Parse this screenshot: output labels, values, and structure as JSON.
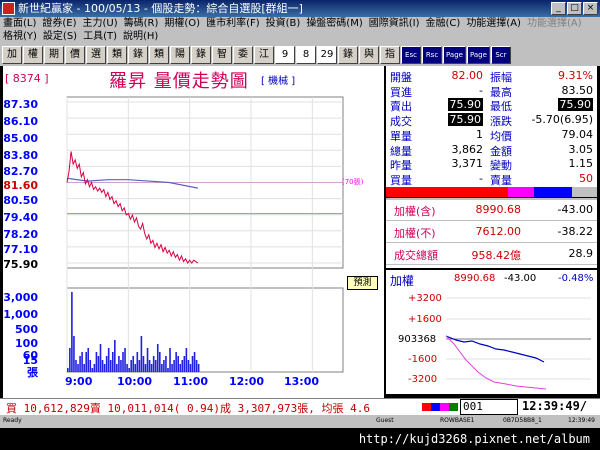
{
  "title": "新世紀贏家 - 100/05/13 - 個股走勢：綜合自選股[群組一]",
  "menu1": [
    "畫面(L)",
    "證券(E)",
    "主力(U)",
    "籌碼(R)",
    "期權(O)",
    "匯市利率(F)",
    "投資(B)",
    "操盤密碼(M)",
    "國際資訊(I)",
    "金融(C)",
    "功能選擇(A)",
    "功能選擇(A)"
  ],
  "menu2": [
    "格視(Y)",
    "設定(S)",
    "工具(T)",
    "說明(H)"
  ],
  "toolbar": [
    "加",
    "權",
    "期",
    "價",
    "選",
    "類",
    "錄",
    "類",
    "陽",
    "錄",
    "智",
    "委",
    "江",
    "9",
    "8",
    "29",
    "錄",
    "與",
    "指",
    "Esc",
    "Rsc",
    "Page",
    "Page",
    "Scr"
  ],
  "stock": {
    "code": "[ 8374 ]",
    "name": "羅昇  量價走勢圖",
    "kind": "[ 機械 ]"
  },
  "axis": {
    "prices": [
      "87.30",
      "86.10",
      "85.00",
      "83.80",
      "82.70",
      "81.60",
      "80.50",
      "79.40",
      "78.20",
      "77.10",
      "75.90"
    ],
    "volumes": [
      "3,000",
      "1,000",
      "500",
      "100",
      "60",
      "30",
      "15"
    ],
    "vol_unit": "張",
    "times": [
      "9:00",
      "10:00",
      "11:00",
      "12:00",
      "13:00"
    ]
  },
  "price_tag": "(70張)",
  "predict": "預測",
  "chart_data": {
    "type": "line",
    "ylim": [
      75.9,
      87.3
    ],
    "xlim_minutes": [
      0,
      270
    ],
    "prev_close": 81.6,
    "price": [
      [
        0,
        81.6
      ],
      [
        2,
        82.4
      ],
      [
        4,
        83.8
      ],
      [
        6,
        82.9
      ],
      [
        8,
        83.2
      ],
      [
        10,
        82.6
      ],
      [
        12,
        82.9
      ],
      [
        14,
        82.0
      ],
      [
        16,
        82.3
      ],
      [
        18,
        81.5
      ],
      [
        20,
        81.8
      ],
      [
        22,
        81.3
      ],
      [
        24,
        81.6
      ],
      [
        26,
        81.1
      ],
      [
        28,
        81.3
      ],
      [
        30,
        81.0
      ],
      [
        32,
        81.2
      ],
      [
        34,
        80.9
      ],
      [
        36,
        81.1
      ],
      [
        38,
        80.6
      ],
      [
        40,
        80.9
      ],
      [
        42,
        80.4
      ],
      [
        44,
        80.6
      ],
      [
        46,
        80.1
      ],
      [
        48,
        80.3
      ],
      [
        50,
        79.9
      ],
      [
        52,
        80.1
      ],
      [
        54,
        79.6
      ],
      [
        56,
        79.8
      ],
      [
        58,
        79.3
      ],
      [
        60,
        79.4
      ],
      [
        62,
        79.0
      ],
      [
        64,
        79.3
      ],
      [
        66,
        78.8
      ],
      [
        68,
        79.1
      ],
      [
        70,
        78.5
      ],
      [
        72,
        78.3
      ],
      [
        74,
        78.7
      ],
      [
        76,
        78.0
      ],
      [
        78,
        77.6
      ],
      [
        80,
        77.9
      ],
      [
        82,
        77.3
      ],
      [
        84,
        77.5
      ],
      [
        86,
        77.0
      ],
      [
        88,
        77.3
      ],
      [
        90,
        76.9
      ],
      [
        92,
        77.2
      ],
      [
        94,
        76.7
      ],
      [
        96,
        77.0
      ],
      [
        98,
        76.6
      ],
      [
        100,
        76.8
      ],
      [
        102,
        76.4
      ],
      [
        104,
        76.7
      ],
      [
        106,
        76.3
      ],
      [
        108,
        76.5
      ],
      [
        110,
        76.1
      ],
      [
        112,
        76.4
      ],
      [
        114,
        76.0
      ],
      [
        116,
        76.2
      ],
      [
        118,
        75.9
      ],
      [
        120,
        76.1
      ],
      [
        122,
        75.9
      ],
      [
        124,
        76.1
      ],
      [
        126,
        76.0
      ],
      [
        128,
        75.9
      ]
    ],
    "avg": [
      [
        0,
        81.9
      ],
      [
        20,
        81.7
      ],
      [
        40,
        81.8
      ],
      [
        60,
        81.8
      ],
      [
        80,
        81.7
      ],
      [
        100,
        81.6
      ],
      [
        128,
        81.2
      ]
    ],
    "volume": [
      1,
      6,
      20,
      9,
      3,
      2,
      4,
      5,
      2,
      5,
      6,
      3,
      1,
      2,
      5,
      4,
      7,
      3,
      2,
      4,
      6,
      3,
      5,
      8,
      2,
      4,
      3,
      5,
      6,
      2,
      1,
      3,
      4,
      2,
      5,
      3,
      9,
      4,
      2,
      6,
      3,
      2,
      4,
      3,
      7,
      5,
      2,
      3,
      4,
      1,
      6,
      2,
      3,
      5,
      4,
      2,
      3,
      4,
      6,
      3,
      2,
      4,
      5,
      3,
      2
    ],
    "vol_max": 20
  },
  "quotes": {
    "rows": [
      {
        "l1": "開盤",
        "v1": "82.00",
        "l2": "振幅",
        "v2": "9.31%"
      },
      {
        "l1": "買進",
        "v1": "-",
        "l2": "最高",
        "v2": "83.50"
      },
      {
        "l1": "賣出",
        "v1": "75.90",
        "l2": "最低",
        "v2": "75.90"
      },
      {
        "l1": "成交",
        "v1": "75.90",
        "l2": "漲跌",
        "v2": "-5.70(6.95)"
      },
      {
        "l1": "單量",
        "v1": "1",
        "l2": "均價",
        "v2": "79.04"
      },
      {
        "l1": "總量",
        "v1": "3,862",
        "l2": "金額",
        "v2": "3.05"
      },
      {
        "l1": "昨量",
        "v1": "3,371",
        "l2": "變動",
        "v2": "1.15"
      },
      {
        "l1": "買量",
        "v1": "-",
        "l2": "賣量",
        "v2": "50"
      }
    ]
  },
  "index": [
    {
      "label": "加權(含)",
      "value": "8990.68",
      "change": "-43.00"
    },
    {
      "label": "加權(不)",
      "value": "7612.00",
      "change": "-38.22"
    },
    {
      "label": "成交總額",
      "value": "958.42億",
      "change": "28.9"
    }
  ],
  "mini": {
    "title": "加權",
    "value": "8990.68",
    "change": "-43.00",
    "pct": "-0.48%",
    "ticks": [
      "+3200",
      "+1600",
      "903368",
      "-1600",
      "-3200"
    ]
  },
  "status": {
    "text": "買 10,612,829賣 10,011,014( 0.94)成 3,307,973張, 均張 4.6",
    "count": "001",
    "clock": "12:39:49/"
  },
  "sysbar": {
    "left": "Ready",
    "guest": "Guest",
    "host": "ROWBASE1",
    "id": "0B7D58B8_1",
    "time": "12:39:49"
  },
  "footer": "http://kujd3268.pixnet.net/album",
  "colors": {
    "price": "#d80040",
    "avg": "#6060c0",
    "volume": "#2020e0",
    "label": "#0000ff",
    "brand": "#d0005a"
  }
}
